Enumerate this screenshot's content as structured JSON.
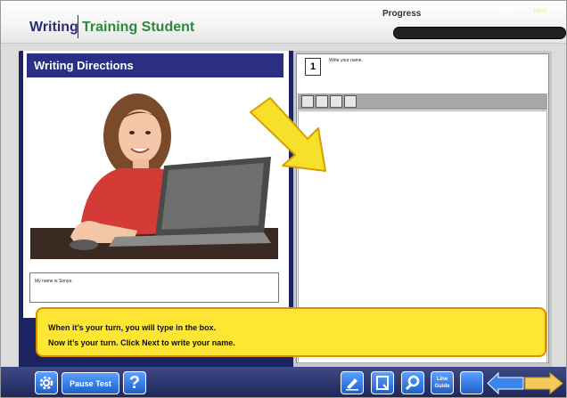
{
  "header": {
    "subject": "Writing",
    "user": "Training Student",
    "progress_label": "Progress",
    "progress_fraction": 0.0
  },
  "left_panel": {
    "title": "Writing Directions",
    "caption": "My name is Sonya."
  },
  "right_panel": {
    "question_number": "1",
    "question_text": "Write your name."
  },
  "callout": {
    "line1": "When it’s your turn, you will type in the box.",
    "line2": "Now it’s your turn. Click Next to write your name."
  },
  "toolbar": {
    "pause_label": "Pause Test",
    "help_label": "?",
    "line_guide_label_1": "Line",
    "line_guide_label_2": "Guide",
    "back_label": "Back",
    "next_label": "Next"
  },
  "colors": {
    "accent_navy": "#1c2361",
    "title_green": "#2a8a3a",
    "callout_yellow": "#ffe633",
    "button_blue": "#2f7ee8"
  },
  "icons": [
    "settings-icon",
    "pencil-icon",
    "notepad-icon",
    "magnifier-icon"
  ]
}
